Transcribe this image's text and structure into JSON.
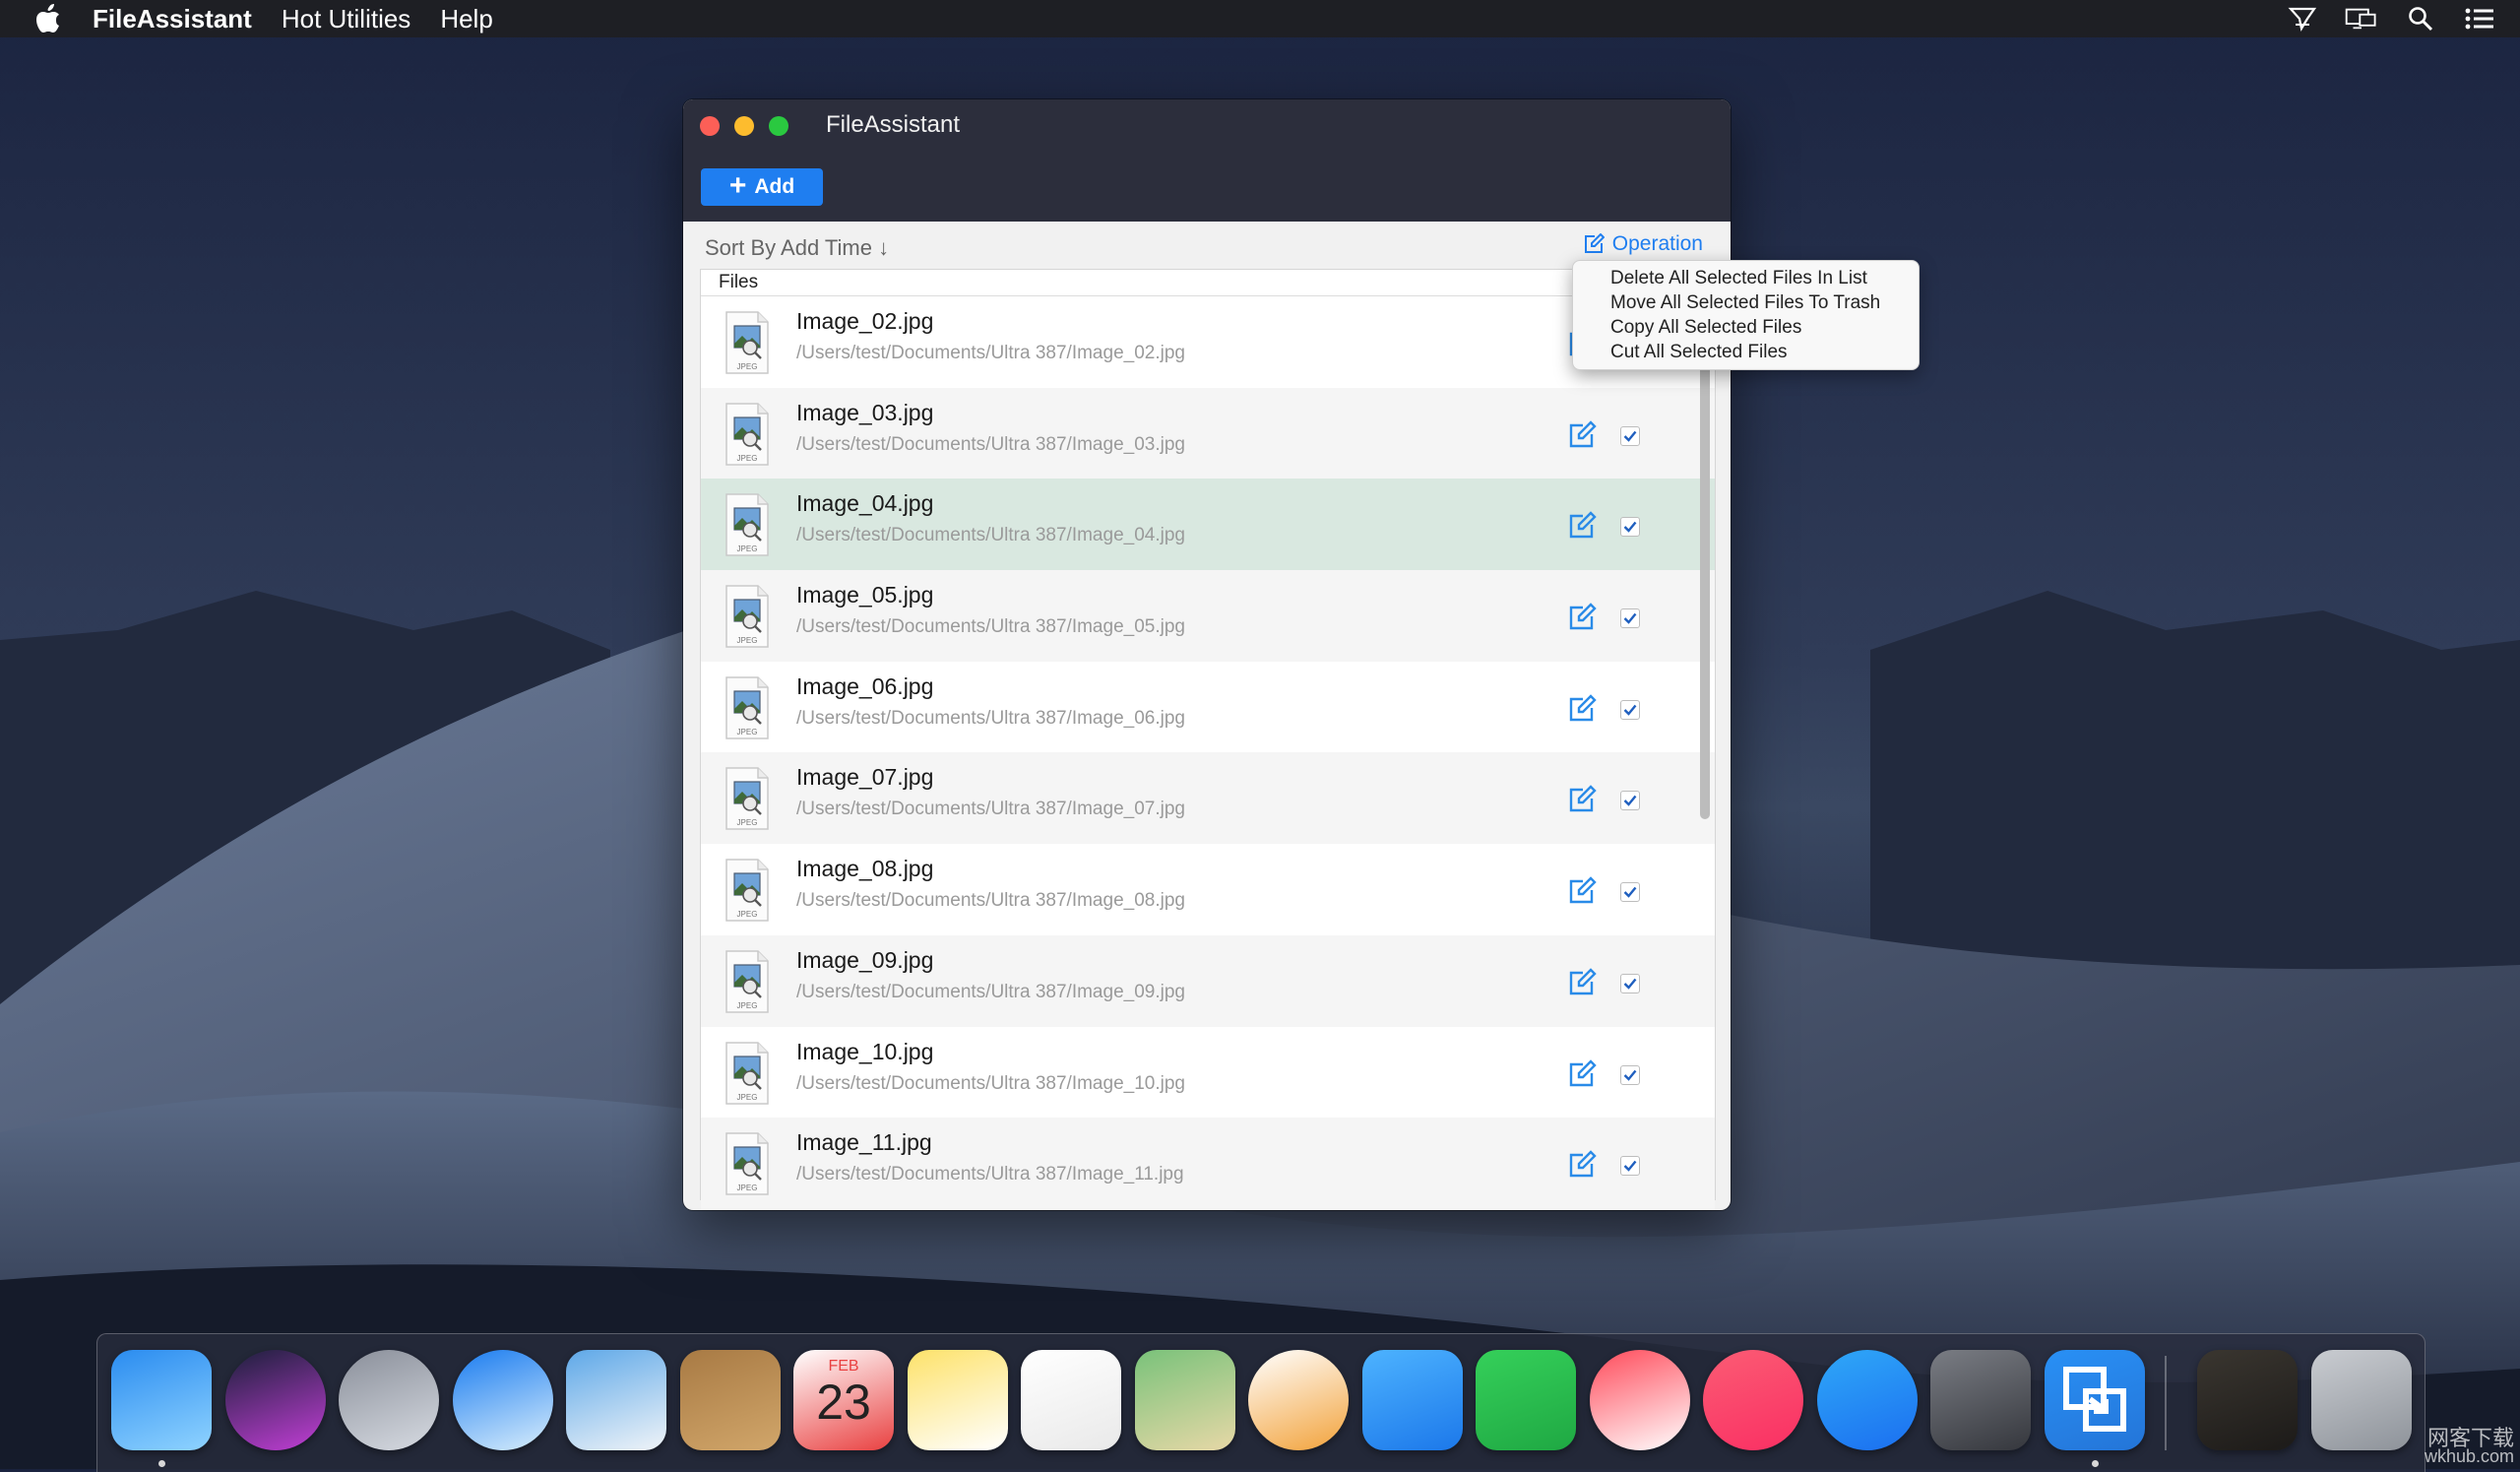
{
  "menubar": {
    "app_name": "FileAssistant",
    "items": [
      "Hot Utilities",
      "Help"
    ],
    "status_icons": [
      "airplay-mirror-icon",
      "display-icon",
      "spotlight-search-icon",
      "notification-center-icon"
    ]
  },
  "window": {
    "title": "FileAssistant",
    "add_label": "Add",
    "sort_label": "Sort By Add Time ↓",
    "operation_label": "Operation",
    "column_header": "Files"
  },
  "operation_menu": {
    "options": [
      "Delete All Selected Files In List",
      "Move All Selected Files To Trash",
      "Copy All Selected Files",
      "Cut All Selected Files"
    ]
  },
  "files": [
    {
      "name": "Image_02.jpg",
      "path": "/Users/test/Documents/Ultra 387/Image_02.jpg",
      "checked": true,
      "selected": false
    },
    {
      "name": "Image_03.jpg",
      "path": "/Users/test/Documents/Ultra 387/Image_03.jpg",
      "checked": true,
      "selected": false
    },
    {
      "name": "Image_04.jpg",
      "path": "/Users/test/Documents/Ultra 387/Image_04.jpg",
      "checked": true,
      "selected": true
    },
    {
      "name": "Image_05.jpg",
      "path": "/Users/test/Documents/Ultra 387/Image_05.jpg",
      "checked": true,
      "selected": false
    },
    {
      "name": "Image_06.jpg",
      "path": "/Users/test/Documents/Ultra 387/Image_06.jpg",
      "checked": true,
      "selected": false
    },
    {
      "name": "Image_07.jpg",
      "path": "/Users/test/Documents/Ultra 387/Image_07.jpg",
      "checked": true,
      "selected": false
    },
    {
      "name": "Image_08.jpg",
      "path": "/Users/test/Documents/Ultra 387/Image_08.jpg",
      "checked": true,
      "selected": false
    },
    {
      "name": "Image_09.jpg",
      "path": "/Users/test/Documents/Ultra 387/Image_09.jpg",
      "checked": true,
      "selected": false
    },
    {
      "name": "Image_10.jpg",
      "path": "/Users/test/Documents/Ultra 387/Image_10.jpg",
      "checked": true,
      "selected": false
    },
    {
      "name": "Image_11.jpg",
      "path": "/Users/test/Documents/Ultra 387/Image_11.jpg",
      "checked": true,
      "selected": false
    }
  ],
  "file_icon_label": "JPEG",
  "dock": {
    "items": [
      {
        "name": "finder-icon",
        "colors": [
          "#2a8cf0",
          "#8fd3ff"
        ],
        "running": true
      },
      {
        "name": "siri-icon",
        "colors": [
          "#1b1f3a",
          "#c23fd6"
        ],
        "running": false
      },
      {
        "name": "launchpad-icon",
        "colors": [
          "#8a8f9a",
          "#d7dbe2"
        ],
        "running": false
      },
      {
        "name": "safari-icon",
        "colors": [
          "#1a7cf0",
          "#d9eefc"
        ],
        "running": false
      },
      {
        "name": "mail-icon",
        "colors": [
          "#5ea8e8",
          "#f0f4f8"
        ],
        "running": false
      },
      {
        "name": "contacts-icon",
        "colors": [
          "#a87a44",
          "#d1a66a"
        ],
        "running": false
      },
      {
        "name": "calendar-icon",
        "colors": [
          "#ffffff",
          "#e94141"
        ],
        "running": false
      },
      {
        "name": "notes-icon",
        "colors": [
          "#fde26a",
          "#ffffff"
        ],
        "running": false
      },
      {
        "name": "reminders-icon",
        "colors": [
          "#ffffff",
          "#e9e9e9"
        ],
        "running": false
      },
      {
        "name": "maps-icon",
        "colors": [
          "#79c27a",
          "#e7d8a7"
        ],
        "running": false
      },
      {
        "name": "photos-icon",
        "colors": [
          "#ffffff",
          "#f2a23a"
        ],
        "running": false
      },
      {
        "name": "messages-icon",
        "colors": [
          "#4db3ff",
          "#1c78ea"
        ],
        "running": false
      },
      {
        "name": "facetime-icon",
        "colors": [
          "#35d05a",
          "#1fa843"
        ],
        "running": false
      },
      {
        "name": "news-icon",
        "colors": [
          "#ff4a5a",
          "#ffffff"
        ],
        "running": false
      },
      {
        "name": "music-icon",
        "colors": [
          "#fb5c74",
          "#fa2f63"
        ],
        "running": false
      },
      {
        "name": "app-store-icon",
        "colors": [
          "#2fa8f8",
          "#1b6ff0"
        ],
        "running": false
      },
      {
        "name": "system-preferences-icon",
        "colors": [
          "#7a7d84",
          "#35373d"
        ],
        "running": false
      },
      {
        "name": "fileassistant-icon",
        "colors": [
          "#2990f5",
          "#2475d8"
        ],
        "running": true
      },
      {
        "name": "downloads-stack-icon",
        "colors": [
          "#3a3630",
          "#1c1a18"
        ],
        "running": false
      },
      {
        "name": "trash-icon",
        "colors": [
          "#c9ccd1",
          "#8e939a"
        ],
        "running": false
      }
    ],
    "calendar_month": "FEB",
    "calendar_day": "23"
  },
  "watermark": {
    "line1": "网客下载",
    "line2": "wkhub.com"
  },
  "colors": {
    "accent": "#1f7ef0",
    "selected_row": "#d9e8e0",
    "titlebar": "#2c2e3c"
  }
}
